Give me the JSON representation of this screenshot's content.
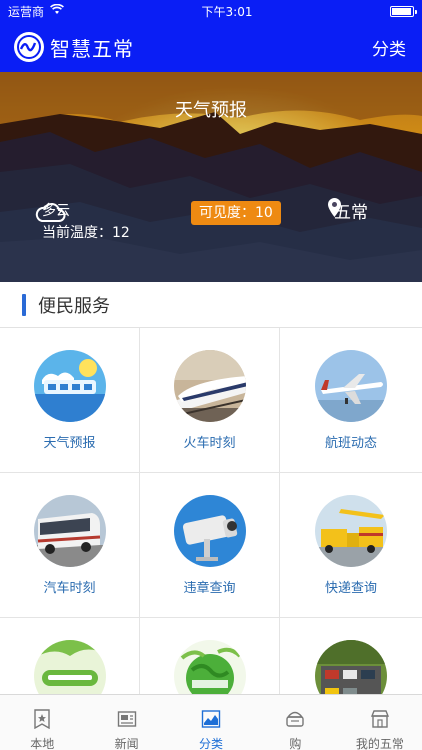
{
  "status_bar": {
    "carrier": "运营商",
    "time": "下午3:01"
  },
  "nav": {
    "title": "智慧五常",
    "right_label": "分类"
  },
  "hero": {
    "title": "天气预报",
    "condition": "多云",
    "temperature": "当前温度：12",
    "visibility": "可见度：10",
    "location": "五常"
  },
  "section": {
    "title": "便民服务"
  },
  "services": [
    {
      "label": "天气预报",
      "icon": "weather-forecast-icon"
    },
    {
      "label": "火车时刻",
      "icon": "train-icon"
    },
    {
      "label": "航班动态",
      "icon": "airplane-icon"
    },
    {
      "label": "汽车时刻",
      "icon": "bus-icon"
    },
    {
      "label": "违章查询",
      "icon": "traffic-camera-icon"
    },
    {
      "label": "快递查询",
      "icon": "delivery-truck-icon"
    },
    {
      "label": "",
      "icon": "utility-payment-icon"
    },
    {
      "label": "",
      "icon": "health-globe-icon"
    },
    {
      "label": "",
      "icon": "parking-icon"
    }
  ],
  "tabs": [
    {
      "label": "本地",
      "icon": "local-icon"
    },
    {
      "label": "新闻",
      "icon": "news-icon"
    },
    {
      "label": "分类",
      "icon": "category-icon",
      "active": true
    },
    {
      "label": "购",
      "icon": "shop-icon"
    },
    {
      "label": "我的五常",
      "icon": "store-icon"
    }
  ],
  "colors": {
    "nav_bg": "#0a1ef5",
    "accent": "#1e6fd6",
    "badge": "#ee8a12"
  }
}
